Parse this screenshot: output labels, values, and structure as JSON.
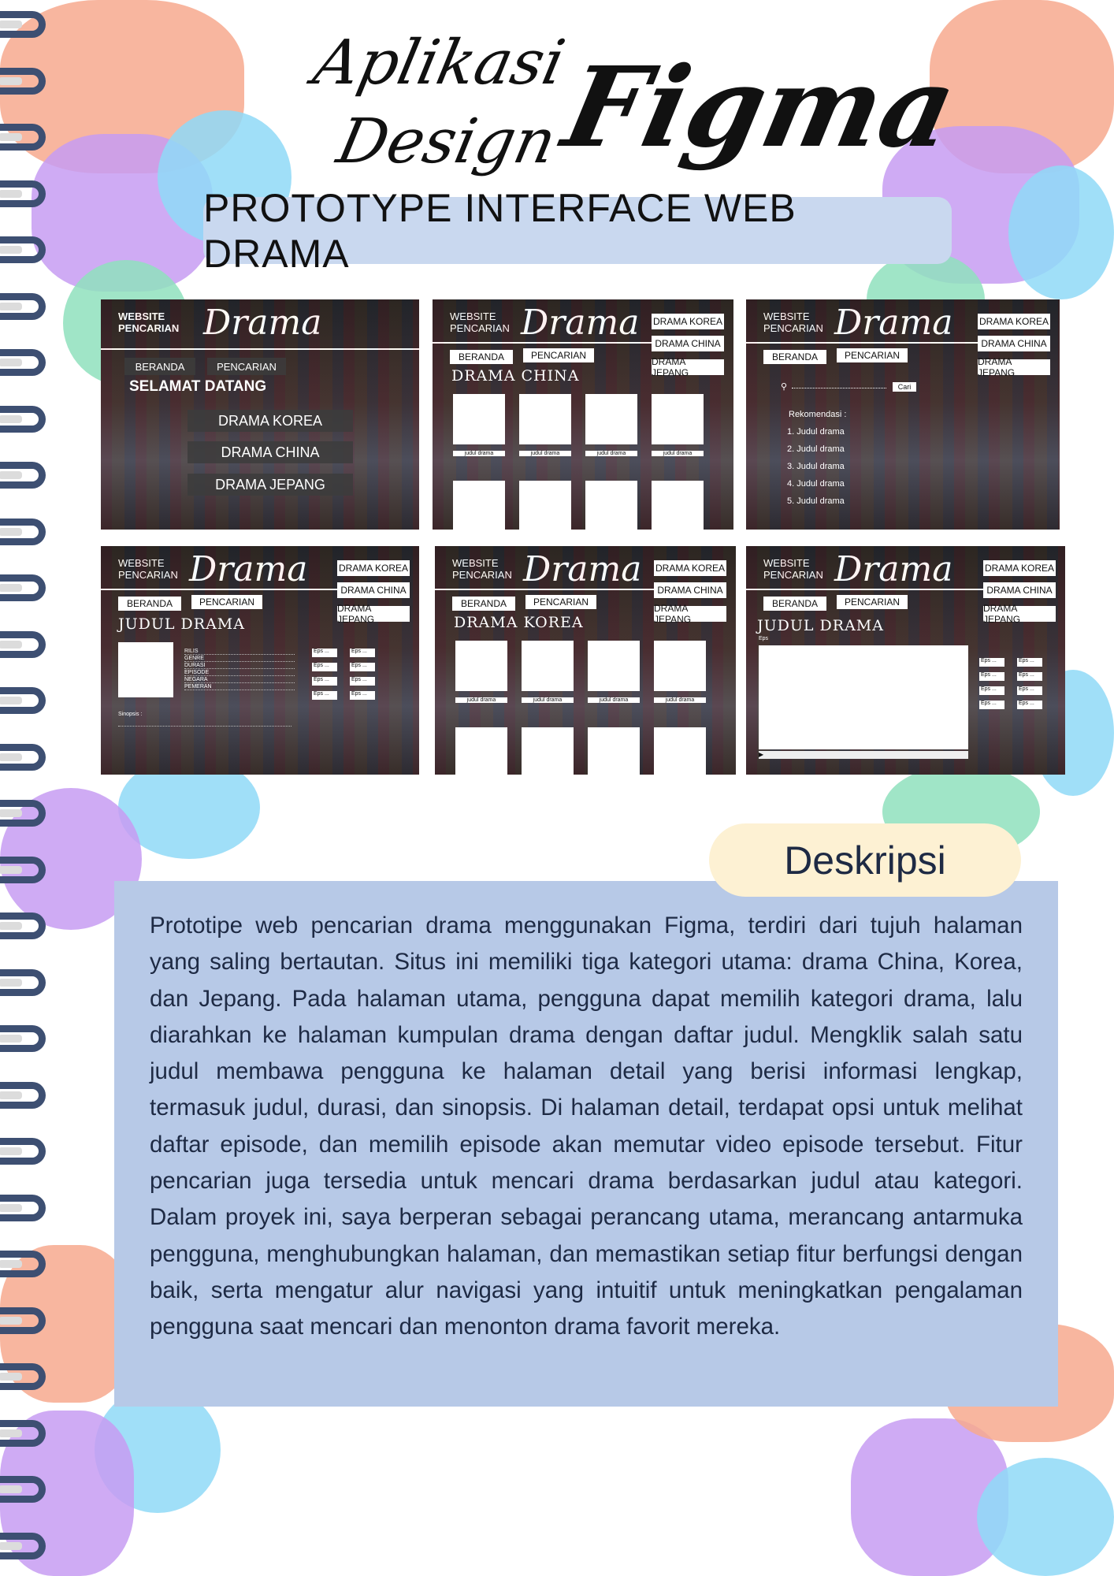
{
  "title": {
    "line1": "Aplikasi",
    "line2": "Design",
    "big": "Figma"
  },
  "banner": "PROTOTYPE INTERFACE WEB DRAMA",
  "common": {
    "website": "WEBSITE",
    "pencarian_head": "PENCARIAN",
    "logo": "Drama",
    "beranda": "BERANDA",
    "pencarian": "PENCARIAN",
    "korea": "DRAMA KOREA",
    "china": "DRAMA CHINA",
    "jepang": "DRAMA JEPANG",
    "judul_item": "judul drama",
    "eps": "Eps ..."
  },
  "home": {
    "welcome": "SELAMAT DATANG"
  },
  "china_page": {
    "heading": "DRAMA CHINA"
  },
  "korea_page": {
    "heading": "DRAMA KOREA"
  },
  "search_page": {
    "button": "Cari",
    "rec_label": "Rekomendasi :",
    "items": [
      "1. Judul drama",
      "2. Judul drama",
      "3. Judul drama",
      "4. Judul drama",
      "5. Judul drama"
    ]
  },
  "detail_page": {
    "heading": "JUDUL DRAMA",
    "fields": [
      "RILIS",
      "GENRE",
      "DURASI",
      "EPISODE",
      "NEGARA",
      "PEMERAN"
    ],
    "sinopsis": "Sinopsis :"
  },
  "video_page": {
    "heading": "JUDUL DRAMA",
    "eps_label": "Eps"
  },
  "description": {
    "heading": "Deskripsi",
    "text": "Prototipe web pencarian drama menggunakan Figma, terdiri dari tujuh halaman yang saling bertautan. Situs ini memiliki tiga kategori utama: drama China, Korea, dan Jepang. Pada halaman utama, pengguna dapat memilih kategori drama, lalu diarahkan ke halaman kumpulan drama dengan daftar judul. Mengklik salah satu judul membawa pengguna ke halaman detail yang berisi informasi lengkap, termasuk judul, durasi, dan sinopsis. Di halaman detail, terdapat opsi untuk melihat daftar episode, dan memilih episode akan memutar video episode tersebut. Fitur pencarian juga tersedia untuk mencari drama berdasarkan judul atau kategori. Dalam proyek ini, saya berperan sebagai perancang utama, merancang antarmuka pengguna, menghubungkan halaman, dan memastikan setiap fitur berfungsi dengan baik, serta mengatur alur navigasi yang intuitif untuk meningkatkan pengalaman pengguna saat mencari dan menonton drama favorit mereka."
  }
}
